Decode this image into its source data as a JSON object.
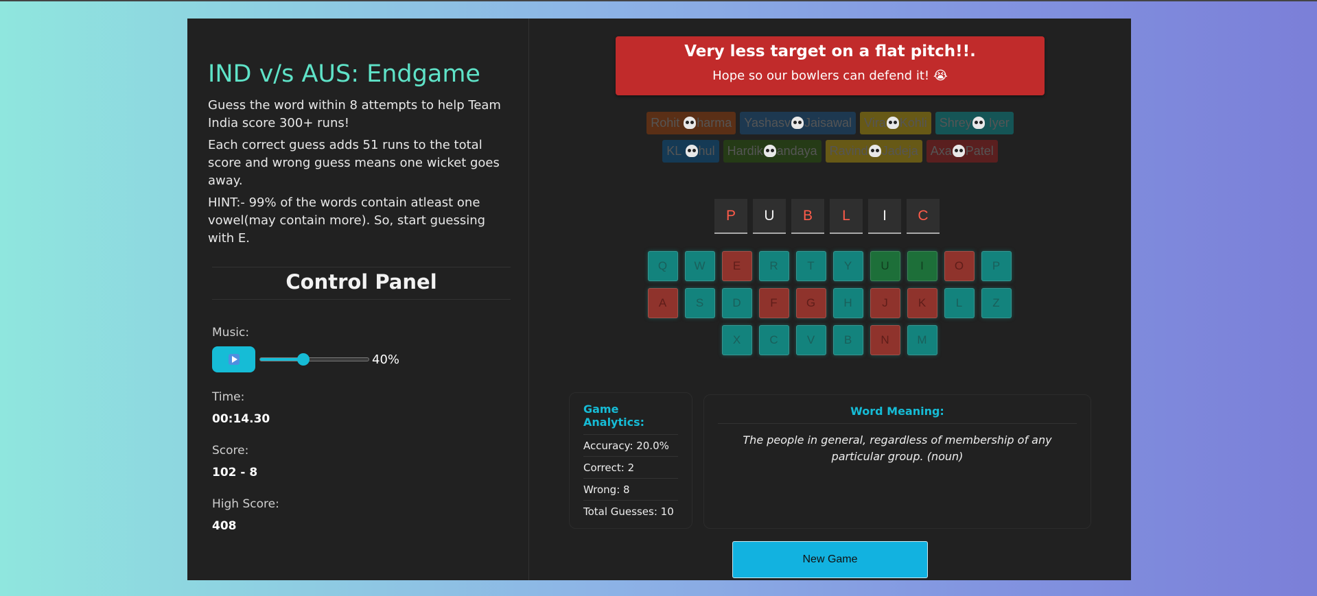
{
  "header": {
    "title": "IND v/s AUS: Endgame",
    "desc1": "Guess the word within 8 attempts to help Team India score 300+ runs!",
    "desc2": "Each correct guess adds 51 runs to the total score and wrong guess means one wicket goes away.",
    "desc3": "HINT:- 99% of the words contain atleast one vowel(may contain more). So, start guessing with E."
  },
  "control_panel": {
    "title": "Control Panel",
    "music_label": "Music:",
    "volume_percent": 40,
    "volume_text": "40%",
    "time_label": "Time:",
    "time_value": "00:14.30",
    "score_label": "Score:",
    "score_value": "102 - 8",
    "high_label": "High Score:",
    "high_value": "408"
  },
  "banner": {
    "line1": "Very less target on a flat pitch!!.",
    "line2": "Hope so our bowlers can defend it! 😭",
    "color": "#c12b2b"
  },
  "players": [
    {
      "a": "Rohit ",
      "b": "harma",
      "color": "#5a2f16"
    },
    {
      "a": "Yashasv",
      "b": "Jaisawal",
      "color": "#1d3850"
    },
    {
      "a": "Vira",
      "b": "Kohli",
      "color": "#675916"
    },
    {
      "a": "Shrey",
      "b": " Iyer",
      "color": "#155556"
    },
    {
      "a": "KL ",
      "b": "hul",
      "color": "#153a55"
    },
    {
      "a": "Hardik",
      "b": "andaya",
      "color": "#253b16"
    },
    {
      "a": "Ravind",
      "b": "Jadeja",
      "color": "#675916"
    },
    {
      "a": "Axa",
      "b": "Patel",
      "color": "#5a1f1f"
    }
  ],
  "word": [
    {
      "ch": "P",
      "color": "#ff5b4a"
    },
    {
      "ch": "U",
      "color": "#f2f2f2"
    },
    {
      "ch": "B",
      "color": "#ff5b4a"
    },
    {
      "ch": "L",
      "color": "#ff5b4a"
    },
    {
      "ch": "I",
      "color": "#f2f2f2"
    },
    {
      "ch": "C",
      "color": "#ff5b4a"
    }
  ],
  "keyboard": {
    "rows": [
      [
        "Q",
        "W",
        "E",
        "R",
        "T",
        "Y",
        "U",
        "I",
        "O",
        "P"
      ],
      [
        "A",
        "S",
        "D",
        "F",
        "G",
        "H",
        "J",
        "K",
        "L",
        "Z"
      ],
      [
        "X",
        "C",
        "V",
        "B",
        "N",
        "M"
      ]
    ],
    "wrong_keys": [
      "E",
      "O",
      "A",
      "F",
      "G",
      "J",
      "K",
      "N"
    ],
    "correct_keys": [
      "U",
      "I"
    ],
    "colors": {
      "normal": "#13837d",
      "wrong": "#8f332c",
      "correct": "#1d6f39"
    }
  },
  "analytics": {
    "title": "Game Analytics:",
    "accuracy": "Accuracy: 20.0%",
    "correct": "Correct: 2",
    "wrong": "Wrong: 8",
    "total": "Total Guesses: 10"
  },
  "meaning": {
    "title": "Word Meaning:",
    "text": "The people in general, regardless of membership of any particular group. (noun)"
  },
  "new_game_label": "New Game"
}
